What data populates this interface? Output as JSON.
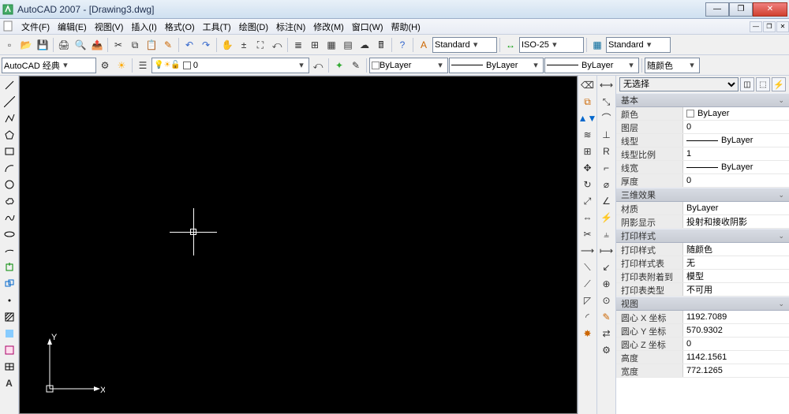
{
  "title": "AutoCAD 2007 - [Drawing3.dwg]",
  "menu": [
    "文件(F)",
    "编辑(E)",
    "视图(V)",
    "插入(I)",
    "格式(O)",
    "工具(T)",
    "绘图(D)",
    "标注(N)",
    "修改(M)",
    "窗口(W)",
    "帮助(H)"
  ],
  "toolbar1": {
    "style_combo1": "Standard",
    "style_combo2": "ISO-25",
    "style_combo3": "Standard"
  },
  "toolbar2": {
    "workspace": "AutoCAD 经典",
    "layer": "0",
    "color_label": "ByLayer",
    "linetype_label": "ByLayer",
    "lineweight_label": "ByLayer",
    "plotcolor": "随颜色"
  },
  "props": {
    "selector": "无选择",
    "groups": [
      {
        "title": "基本",
        "rows": [
          {
            "n": "颜色",
            "v": "ByLayer",
            "swatch": true
          },
          {
            "n": "图层",
            "v": "0"
          },
          {
            "n": "线型",
            "v": "ByLayer",
            "line": true
          },
          {
            "n": "线型比例",
            "v": "1"
          },
          {
            "n": "线宽",
            "v": "ByLayer",
            "line": true
          },
          {
            "n": "厚度",
            "v": "0"
          }
        ]
      },
      {
        "title": "三维效果",
        "rows": [
          {
            "n": "材质",
            "v": "ByLayer"
          },
          {
            "n": "阴影显示",
            "v": "投射和接收阴影"
          }
        ]
      },
      {
        "title": "打印样式",
        "rows": [
          {
            "n": "打印样式",
            "v": "随颜色"
          },
          {
            "n": "打印样式表",
            "v": "无"
          },
          {
            "n": "打印表附着到",
            "v": "模型"
          },
          {
            "n": "打印表类型",
            "v": "不可用"
          }
        ]
      },
      {
        "title": "视图",
        "rows": [
          {
            "n": "圆心 X 坐标",
            "v": "1192.7089"
          },
          {
            "n": "圆心 Y 坐标",
            "v": "570.9302"
          },
          {
            "n": "圆心 Z 坐标",
            "v": "0"
          },
          {
            "n": "高度",
            "v": "1142.1561"
          },
          {
            "n": "宽度",
            "v": "772.1265"
          }
        ]
      }
    ]
  },
  "ucs": {
    "x": "X",
    "y": "Y"
  }
}
